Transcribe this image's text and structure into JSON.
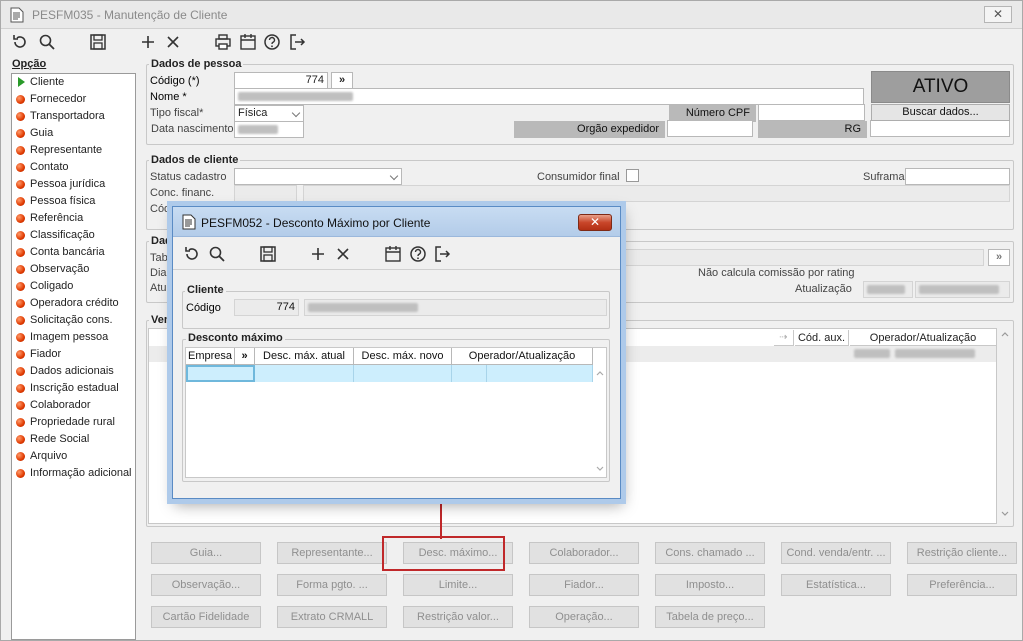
{
  "window": {
    "title": "PESFM035 - Manutenção de Cliente",
    "close_glyph": "✕"
  },
  "toolbar_icons": [
    "undo-icon",
    "search-icon",
    "save-icon",
    "add-icon",
    "delete-icon",
    "print-icon",
    "calendar-icon",
    "help-icon",
    "exit-icon"
  ],
  "sidebar": {
    "title": "Opção",
    "items": [
      {
        "label": "Cliente",
        "active": true
      },
      {
        "label": "Fornecedor"
      },
      {
        "label": "Transportadora"
      },
      {
        "label": "Guia"
      },
      {
        "label": "Representante"
      },
      {
        "label": "Contato"
      },
      {
        "label": "Pessoa jurídica"
      },
      {
        "label": "Pessoa física"
      },
      {
        "label": "Referência"
      },
      {
        "label": "Classificação"
      },
      {
        "label": "Conta bancária"
      },
      {
        "label": "Observação"
      },
      {
        "label": "Coligado"
      },
      {
        "label": "Operadora crédito"
      },
      {
        "label": "Solicitação cons."
      },
      {
        "label": "Imagem pessoa"
      },
      {
        "label": "Fiador"
      },
      {
        "label": "Dados adicionais"
      },
      {
        "label": "Inscrição estadual"
      },
      {
        "label": "Colaborador"
      },
      {
        "label": "Propriedade rural"
      },
      {
        "label": "Rede Social"
      },
      {
        "label": "Arquivo"
      },
      {
        "label": "Informação adicional"
      }
    ]
  },
  "pessoa": {
    "group_label": "Dados de pessoa",
    "codigo_label": "Código (*)",
    "codigo_value": "774",
    "nav_glyph": "»",
    "nome_label": "Nome *",
    "tipo_fiscal_label": "Tipo fiscal*",
    "tipo_fiscal_value": "Física",
    "data_nasc_label": "Data nascimento",
    "numero_cpf_label": "Número CPF",
    "orgao_label": "Orgão expedidor",
    "rg_label": "RG",
    "status": "ATIVO",
    "buscar_button": "Buscar dados..."
  },
  "cliente": {
    "group_label": "Dados de cliente",
    "status_cadastro_label": "Status cadastro",
    "consumidor_final_label": "Consumidor final",
    "suframa_label": "Suframa",
    "conc_financ_label": "Conc. financ.",
    "cod_label": "Códi"
  },
  "dados3": {
    "group_label": "Dad",
    "tab_label": "Tab",
    "dia_label": "Dia",
    "atua_label": "Atua",
    "nao_calcula_label": "Não calcula comissão por rating",
    "atualizacao_label": "Atualização",
    "link_glyph": "»"
  },
  "vendas": {
    "group_label": "Ven",
    "col_cod_aux": "Cód. aux.",
    "col_operador": "Operador/Atualização"
  },
  "dialog": {
    "title": "PESFM052 - Desconto Máximo por Cliente",
    "close_glyph": "✕",
    "cliente_group": "Cliente",
    "codigo_label": "Código",
    "codigo_value": "774",
    "desconto_group": "Desconto máximo",
    "columns": [
      "Empresa",
      "»",
      "Desc. máx. atual",
      "Desc. máx. novo",
      "Operador/Atualização"
    ]
  },
  "buttons": {
    "row1": [
      "Guia...",
      "Representante...",
      "Desc. máximo...",
      "Colaborador...",
      "Cons. chamado ...",
      "Cond. venda/entr. ...",
      "Restrição cliente..."
    ],
    "row2": [
      "Observação...",
      "Forma pgto. ...",
      "Limite...",
      "Fiador...",
      "Imposto...",
      "Estatística...",
      "Preferência..."
    ],
    "row3": [
      "Cartão Fidelidade",
      "Extrato CRMALL",
      "Restrição valor...",
      "Operação...",
      "Tabela de preço..."
    ]
  },
  "colors": {
    "highlight": "#c0282a",
    "active_arrow": "#2a9a2a",
    "dialog_border": "#5a8bc4",
    "selected_row": "#cdeefd"
  }
}
